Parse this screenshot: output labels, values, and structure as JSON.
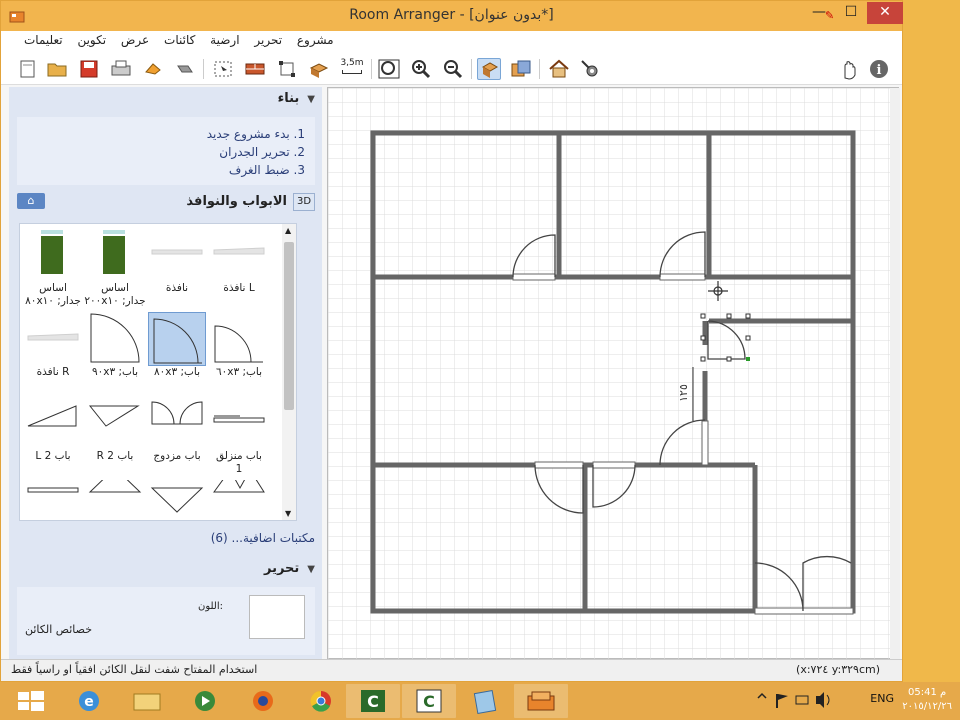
{
  "window": {
    "title": "Room Arranger - [بدون عنوان*]",
    "minimize_label": "—",
    "maximize_label": "☐",
    "close_label": "✕",
    "edited_icon": "pencil-icon"
  },
  "menu": [
    "مشروع",
    "تحرير",
    "ارضية",
    "كائنات",
    "عرض",
    "تكوين",
    "تعليمات"
  ],
  "toolbar": {
    "buttons": [
      "new-icon",
      "open-folder-icon",
      "save-icon",
      "print-icon",
      "undo-icon",
      "redo-icon",
      "select-icon",
      "wall-icon",
      "resize-icon",
      "object-icon",
      "measure-icon",
      "zoom-fit-icon",
      "zoom-in-icon",
      "zoom-out-icon",
      "2d-view-icon",
      "3d-view-icon",
      "house-icon",
      "settings-icon",
      "hand-icon",
      "info-icon"
    ],
    "measure_label": "3,5m"
  },
  "sidebar": {
    "build_title": "بناء",
    "build_steps": [
      "1. بدء مشروع جديد",
      "2. تحرير الجدران",
      "3. ضبط الغرف"
    ],
    "library_title": "الابواب والنوافذ",
    "library_3d": "3D",
    "library_items": [
      {
        "label": "اساس",
        "sub": "جدار; ٨٠x١٠"
      },
      {
        "label": "اساس",
        "sub": "جدار; ٢٠٠x١٠"
      },
      {
        "label": "نافذة",
        "sub": ""
      },
      {
        "label": "L نافذة",
        "sub": ""
      },
      {
        "label": "R نافذة",
        "sub": ""
      },
      {
        "label": "باب; ٩٠x٣",
        "sub": ""
      },
      {
        "label": "باب; ٨٠x٣",
        "sub": ""
      },
      {
        "label": "باب; ٦٠x٣",
        "sub": ""
      },
      {
        "label": "باب 2 L",
        "sub": ""
      },
      {
        "label": "باب 2 R",
        "sub": ""
      },
      {
        "label": "باب مزدوج",
        "sub": ""
      },
      {
        "label": "باب منزلق",
        "sub": "1"
      }
    ],
    "more_libraries": "مكتبات اضافية... (6)",
    "edit_title": "تحرير",
    "color_label": "اللون:",
    "props_label": "خصائص الكائن"
  },
  "status": {
    "hint": "استخدام المفتاح شفت لنقل الكائن افقياً او راسياً فقط",
    "coords": "(x:٧٢٤ y:٣٢٩cm)"
  },
  "plan": {
    "dimension_label": "١٢٥"
  },
  "taskbar": {
    "apps": [
      "windows-start-icon",
      "internet-explorer-icon",
      "file-explorer-icon",
      "media-player-icon",
      "firefox-icon",
      "chrome-icon",
      "camtasia-icon",
      "camtasia-recorder-icon",
      "notepad-icon",
      "room-arranger-icon"
    ],
    "language": "ENG",
    "time": "م 05:41",
    "date": "٢٠١٥/١٢/٢٦"
  }
}
